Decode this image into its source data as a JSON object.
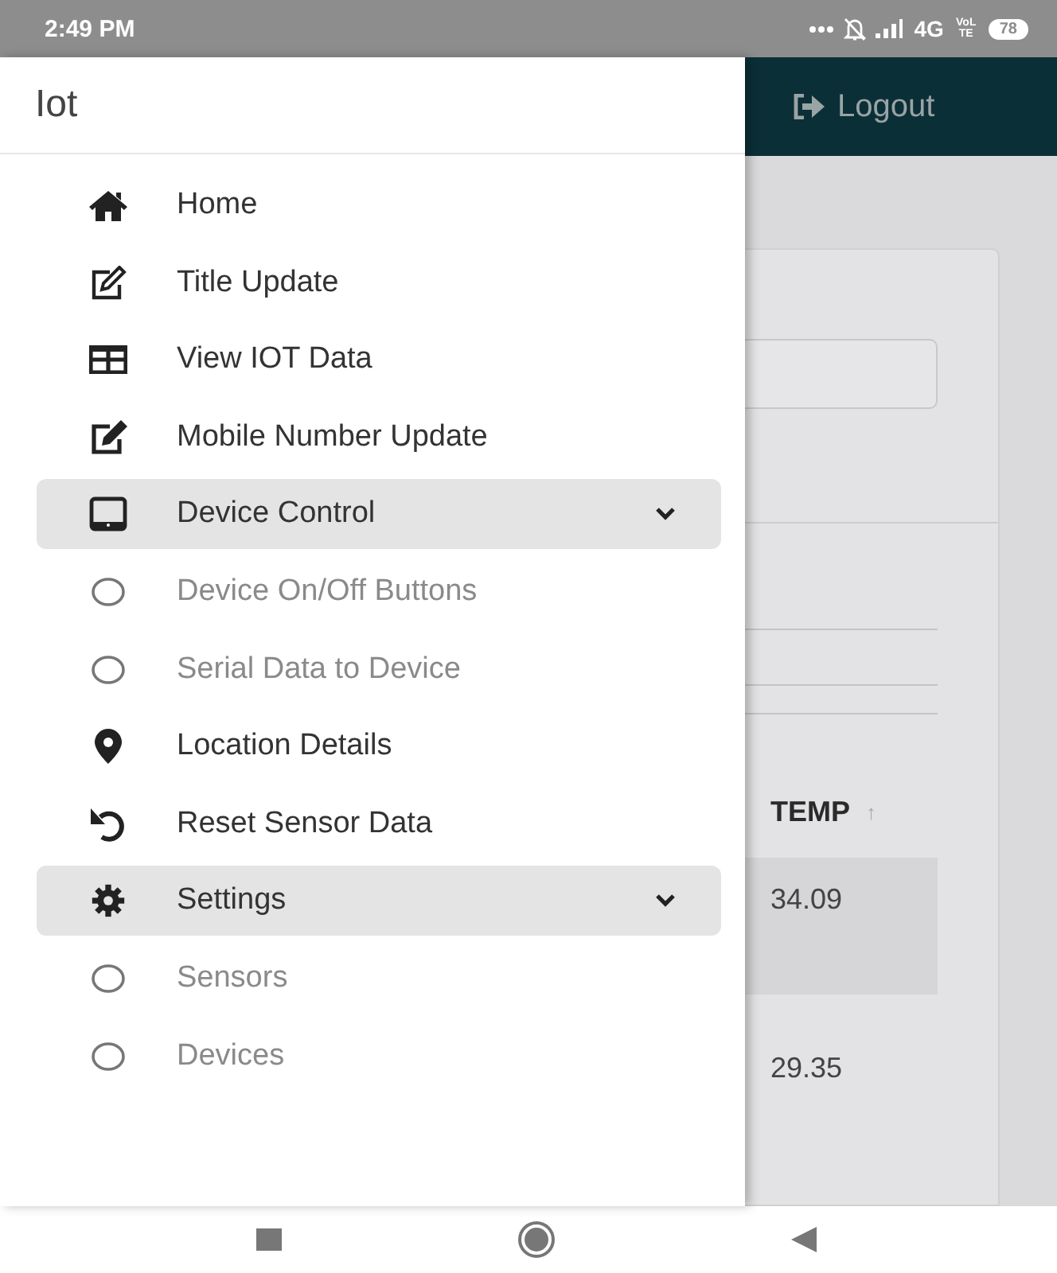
{
  "status_bar": {
    "time": "2:49 PM",
    "network": "4G",
    "volte": "VoLTE",
    "battery": "78"
  },
  "drawer": {
    "title": "Iot",
    "items": [
      {
        "kind": "link",
        "label": "Home"
      },
      {
        "kind": "link",
        "label": "Title Update"
      },
      {
        "kind": "link",
        "label": "View IOT Data"
      },
      {
        "kind": "link",
        "label": "Mobile Number Update"
      },
      {
        "kind": "group",
        "label": "Device Control",
        "expanded": true,
        "children": [
          {
            "label": "Device On/Off Buttons"
          },
          {
            "label": "Serial Data to Device"
          }
        ]
      },
      {
        "kind": "link",
        "label": "Location Details"
      },
      {
        "kind": "link",
        "label": "Reset Sensor Data"
      },
      {
        "kind": "group",
        "label": "Settings",
        "expanded": true,
        "children": [
          {
            "label": "Sensors"
          },
          {
            "label": "Devices"
          }
        ]
      }
    ]
  },
  "top_bar": {
    "logout": "Logout"
  },
  "table": {
    "columns": [
      {
        "label": "TEMP",
        "sort": "↑"
      }
    ],
    "rows": [
      {
        "cells": [
          "34.09"
        ],
        "selected": true
      },
      {
        "cells": [
          "29.35"
        ],
        "selected": false
      }
    ]
  }
}
